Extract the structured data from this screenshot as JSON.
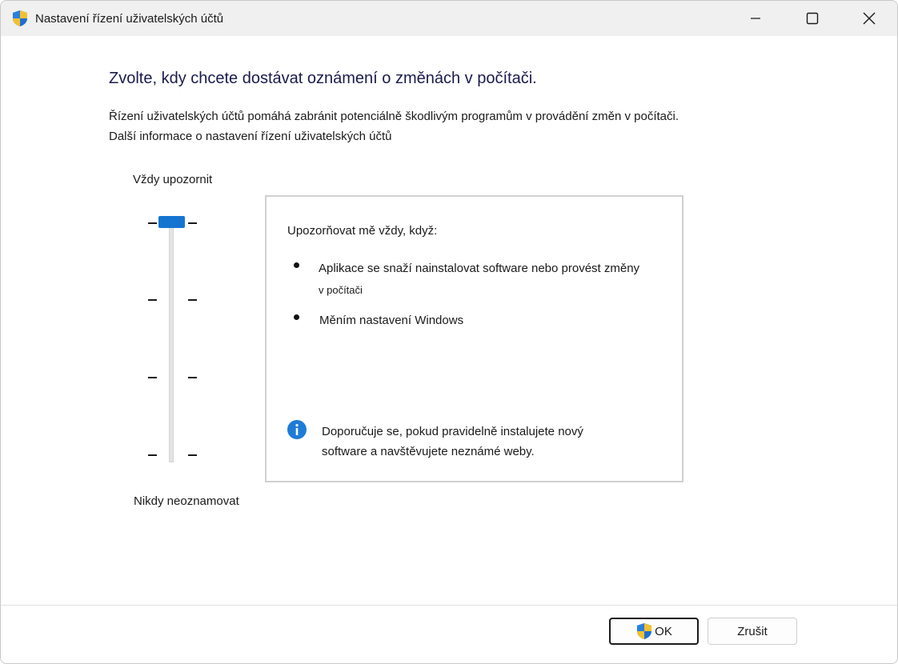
{
  "window": {
    "title": "Nastavení řízení uživatelských účtů",
    "shield_icon": "uac-shield-icon",
    "controls": [
      "minimize-icon",
      "maximize-icon",
      "close-icon"
    ]
  },
  "header": {
    "heading": "Zvolte, kdy chcete dostávat oznámení o změnách v počítači.",
    "description": "Řízení uživatelských účtů pomáhá zabránit potenciálně škodlivým programům v provádění změn v počítači.",
    "more_info_link": "Další informace o nastavení řízení uživatelských účtů"
  },
  "slider": {
    "label_top": "Vždy upozornit",
    "label_bottom": "Nikdy neoznamovat",
    "levels": 4,
    "selected_level": 4,
    "accent": "#1674d1"
  },
  "info_panel": {
    "title": "Upozorňovat mě vždy, když:",
    "bullets": [
      {
        "line1": "Aplikace se snaží nainstalovat software nebo provést změny",
        "line2": "v počítači"
      },
      {
        "line1": "Měním nastavení Windows"
      }
    ],
    "recommendation_icon": "info-icon",
    "recommendation_line1": "Doporučuje se, pokud pravidelně instalujete nový",
    "recommendation_line2": "software a navštěvujete neznámé weby."
  },
  "buttons": {
    "ok": "OK",
    "cancel": "Zrušit"
  }
}
